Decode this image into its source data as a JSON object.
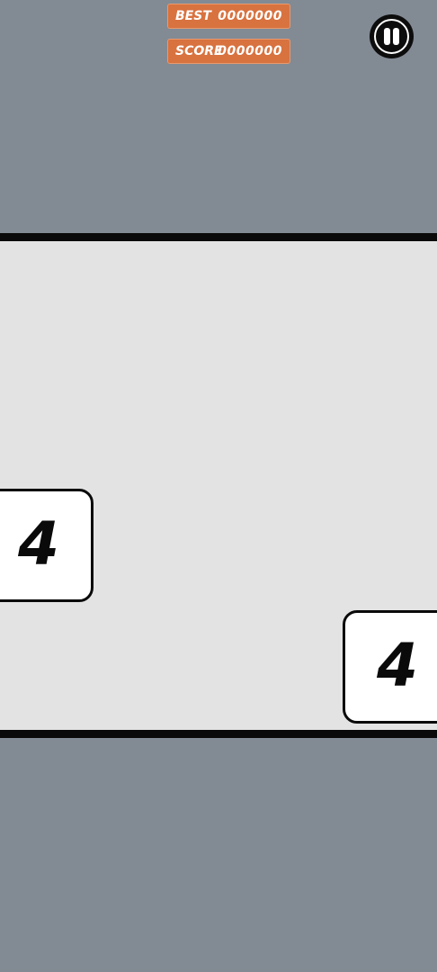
{
  "hud": {
    "best_label": "BEST",
    "best_value": "0000000",
    "score_label": "SCORE",
    "score_value": "0000000"
  },
  "pause_button": {
    "icon": "pause-icon"
  },
  "tiles": [
    {
      "value": "4"
    },
    {
      "value": "4"
    }
  ],
  "colors": {
    "background": "#828a94",
    "play_area": "#e3e3e3",
    "hud_pill": "#d8723f",
    "border": "#0a0a0a",
    "tile": "#ffffff"
  }
}
